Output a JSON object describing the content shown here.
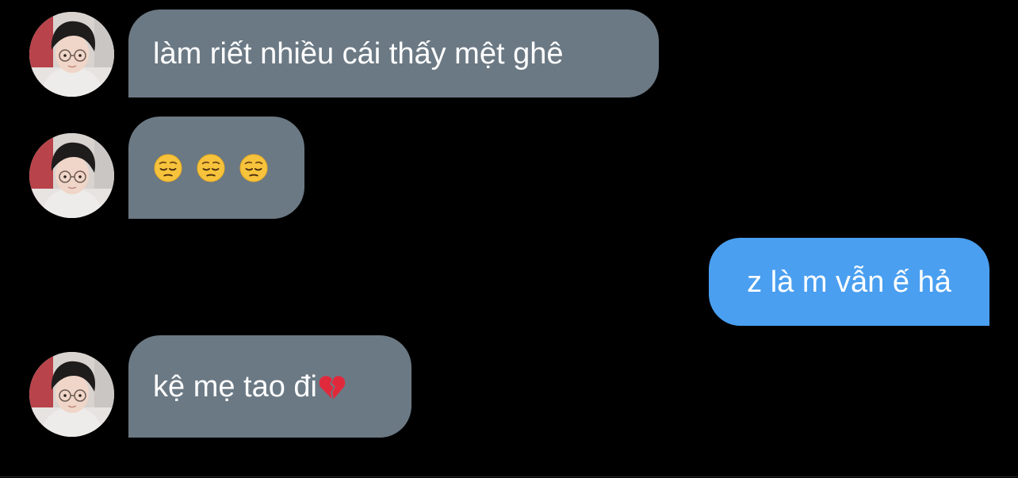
{
  "messages": [
    {
      "sender": "other",
      "text": "làm riết nhiều cái thấy mệt ghê"
    },
    {
      "sender": "other",
      "emojis": [
        "pensive-face",
        "pensive-face",
        "pensive-face"
      ]
    },
    {
      "sender": "me",
      "text": "z là m vẫn ế hả"
    },
    {
      "sender": "other",
      "text": "kệ mẹ tao đi",
      "trailing_emoji": "broken-heart"
    }
  ],
  "colors": {
    "background": "#000000",
    "incoming_bubble": "#6b7984",
    "outgoing_bubble": "#4a9ff0",
    "text": "#ffffff"
  }
}
